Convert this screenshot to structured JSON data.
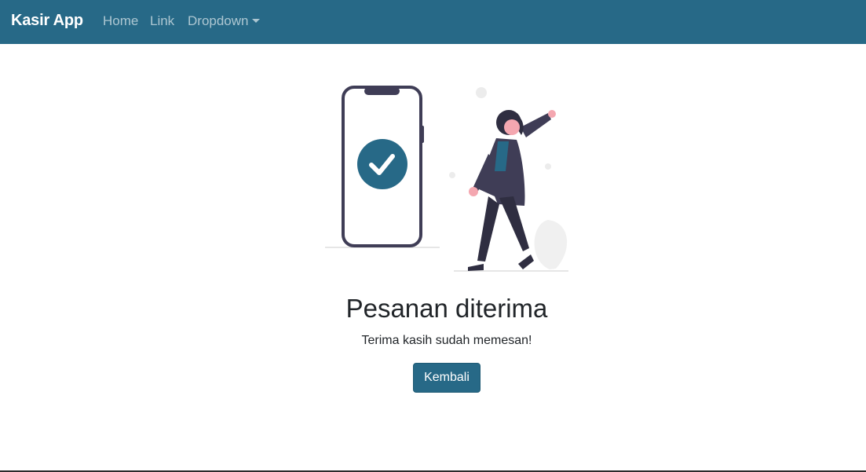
{
  "navbar": {
    "brand": "Kasir App",
    "items": [
      {
        "label": "Home"
      },
      {
        "label": "Link"
      },
      {
        "label": "Dropdown"
      }
    ]
  },
  "main": {
    "title": "Pesanan diterima",
    "subtitle": "Terima kasih sudah memesan!",
    "back_button": "Kembali"
  },
  "colors": {
    "primary": "#276987",
    "figure_dark": "#3f3d56",
    "skin": "#f4a7b0"
  },
  "icons": {
    "illustration": "order-success-illustration",
    "check": "check-icon"
  }
}
